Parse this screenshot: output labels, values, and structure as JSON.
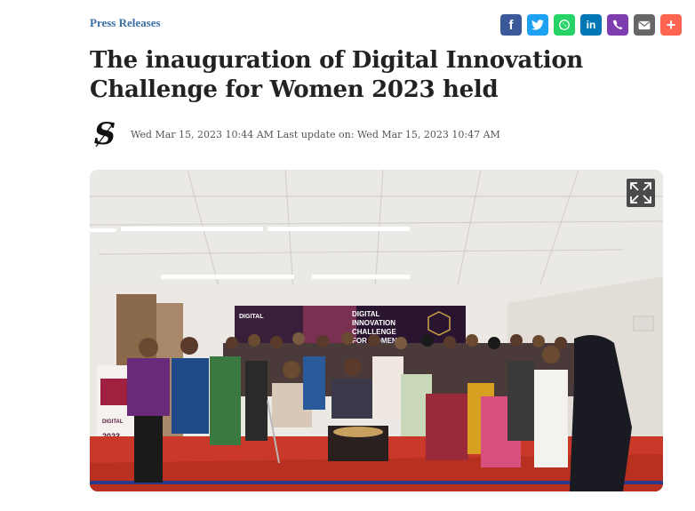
{
  "category": "Press Releases",
  "share": [
    {
      "name": "facebook",
      "color": "#3b5998",
      "glyph": "f"
    },
    {
      "name": "twitter",
      "color": "#1da1f2",
      "glyph": ""
    },
    {
      "name": "whatsapp",
      "color": "#25d366",
      "glyph": ""
    },
    {
      "name": "linkedin",
      "color": "#0077b5",
      "glyph": "in"
    },
    {
      "name": "viber",
      "color": "#7d3daf",
      "glyph": ""
    },
    {
      "name": "email",
      "color": "#666666",
      "glyph": ""
    },
    {
      "name": "more",
      "color": "#ff6550",
      "glyph": "+"
    }
  ],
  "article": {
    "title": "The inauguration of Digital Innovation Challenge for Women 2023 held",
    "meta": "Wed Mar 15, 2023 10:44 AM Last update on: Wed Mar 15, 2023 10:47 AM",
    "logo_icon": "daily-star-s-logo"
  },
  "photo": {
    "banner_line1": "DIGITAL",
    "banner_line2": "INNOVATION",
    "banner_line3": "CHALLENGE",
    "banner_line4": "FOR WOMEN",
    "banner_year": "2023",
    "expand_icon": "expand-icon"
  }
}
